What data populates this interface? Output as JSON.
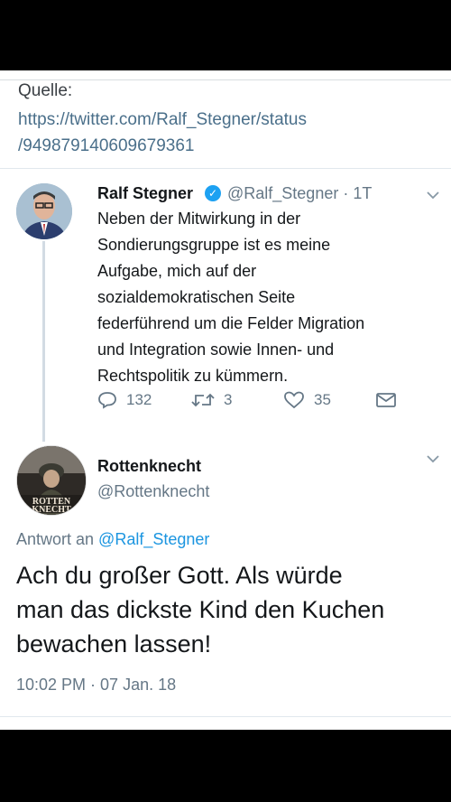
{
  "source": {
    "label": "Quelle:",
    "url_line1": "https://twitter.com/Ralf_Stegner/status",
    "url_line2": "/949879140609679361"
  },
  "tweet1": {
    "name": "Ralf Stegner",
    "handle_time": "@Ralf_Stegner · 1T",
    "text": "Neben der Mitwirkung in der\nSondierungsgruppe  ist es meine\nAufgabe, mich auf der\nsozialdemokratischen Seite\nfederführend um die Felder Migration\nund Integration sowie Innen- und\nRechtspolitik zu kümmern.",
    "replies": "132",
    "retweets": "3",
    "likes": "35"
  },
  "tweet2": {
    "name": "Rottenknecht",
    "handle": "@Rottenknecht",
    "avatar_text": "ROTTEN KNECHT",
    "reply_prefix": "Antwort an ",
    "reply_to": "@Ralf_Stegner",
    "text": "Ach du großer Gott. Als würde\nman das dickste Kind den Kuchen\nbewachen lassen!",
    "timestamp": "10:02 PM · 07 Jan. 18"
  },
  "colors": {
    "link": "#1b95e0",
    "muted": "#657786",
    "verified": "#1da1f2"
  }
}
